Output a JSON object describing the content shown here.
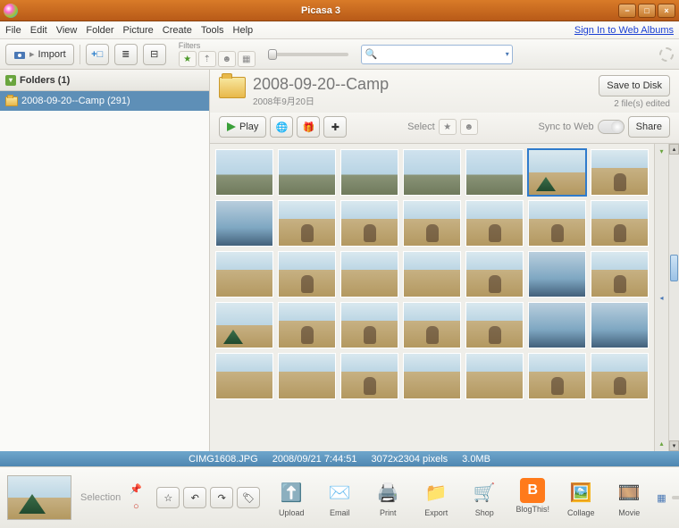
{
  "window": {
    "title": "Picasa 3"
  },
  "menu": {
    "file": "File",
    "edit": "Edit",
    "view": "View",
    "folder": "Folder",
    "picture": "Picture",
    "create": "Create",
    "tools": "Tools",
    "help": "Help",
    "signin": "Sign In to Web Albums"
  },
  "toolbar": {
    "import": "Import",
    "filters_label": "Filters",
    "search_placeholder": ""
  },
  "sidebar": {
    "header": "Folders (1)",
    "items": [
      {
        "label": "2008-09-20--Camp (291)"
      }
    ]
  },
  "folder": {
    "name": "2008-09-20--Camp",
    "date": "2008年9月20日",
    "save_to_disk": "Save to Disk",
    "edited": "2 file(s) edited"
  },
  "actions": {
    "play": "Play",
    "select": "Select",
    "sync": "Sync to Web",
    "share": "Share"
  },
  "status": {
    "file": "CIMG1608.JPG",
    "ts": "2008/09/21 7:44:51",
    "dim": "3072x2304 pixels",
    "size": "3.0MB"
  },
  "bottom": {
    "selection": "Selection",
    "upload": "Upload",
    "email": "Email",
    "print": "Print",
    "export": "Export",
    "shop": "Shop",
    "blog": "BlogThis!",
    "collage": "Collage",
    "movie": "Movie"
  }
}
